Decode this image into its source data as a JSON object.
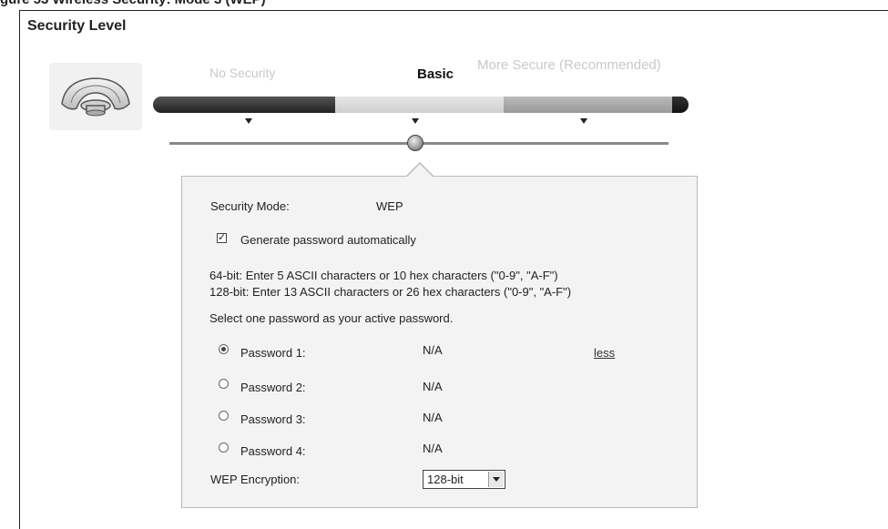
{
  "caption": "gure 53   Wireless Security: Mode 3 (WEP)",
  "title": "Security Level",
  "slider": {
    "labels": [
      "No Security",
      "Basic",
      "More Secure (Recommended)"
    ],
    "selected": "Basic"
  },
  "panel": {
    "security_mode_label": "Security Mode:",
    "security_mode_value": "WEP",
    "generate_label": "Generate password automatically",
    "generate_checked": true,
    "hint_64": "64-bit: Enter 5 ASCII characters or 10 hex characters (\"0-9\", \"A-F\")",
    "hint_128": "128-bit: Enter 13 ASCII characters or 26 hex characters (\"0-9\", \"A-F\")",
    "select_prompt": "Select one password as your active password.",
    "passwords": [
      {
        "label": "Password 1:",
        "value": "N/A",
        "selected": true
      },
      {
        "label": "Password 2:",
        "value": "N/A",
        "selected": false
      },
      {
        "label": "Password 3:",
        "value": "N/A",
        "selected": false
      },
      {
        "label": "Password 4:",
        "value": "N/A",
        "selected": false
      }
    ],
    "less_link": "less",
    "encryption_label": "WEP Encryption:",
    "encryption_value": "128-bit"
  },
  "icons": {
    "wireless": "wireless-router-icon",
    "checkbox_mark": "checkmark-icon",
    "dropdown": "chevron-down-icon"
  }
}
